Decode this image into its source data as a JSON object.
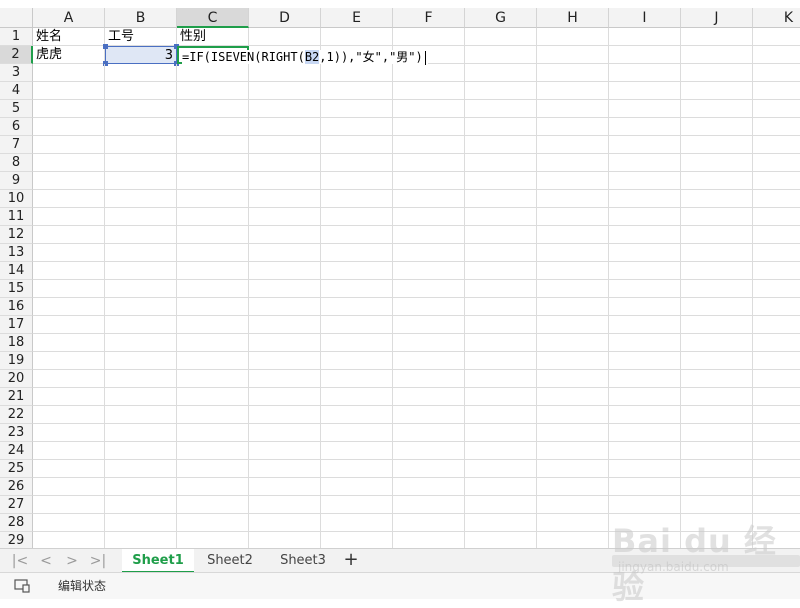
{
  "columns": [
    "A",
    "B",
    "C",
    "D",
    "E",
    "F",
    "G",
    "H",
    "I",
    "J",
    "K"
  ],
  "active_column": "C",
  "row_numbers": [
    "1",
    "2",
    "3",
    "4",
    "5",
    "6",
    "7",
    "8",
    "9",
    "10",
    "11",
    "12",
    "13",
    "14",
    "15",
    "16",
    "17",
    "18",
    "19",
    "20",
    "21",
    "22",
    "23",
    "24",
    "25",
    "26",
    "27",
    "28",
    "29"
  ],
  "active_row": "2",
  "cells": {
    "A1": "姓名",
    "B1": "工号",
    "C1": "性别",
    "A2": "虎虎",
    "B2": "3"
  },
  "formula": {
    "prefix": "=IF(ISEVEN(RIGHT(",
    "ref": "B2",
    "suffix": ",1)),\"女\",\"男\")"
  },
  "sheet_tabs": [
    "Sheet1",
    "Sheet2",
    "Sheet3"
  ],
  "active_sheet": "Sheet1",
  "nav_buttons": {
    "first": "|<",
    "prev": "<",
    "next": ">",
    "last": ">|"
  },
  "add_sheet_label": "+",
  "status": {
    "mode_text": "编辑状态"
  },
  "watermark": {
    "logo": "Bai du 经验",
    "url": "jingyan.baidu.com"
  },
  "colors": {
    "accent": "#1f9e4a",
    "selection": "#4a6fc2",
    "selection_fill": "#dfe7f5"
  }
}
